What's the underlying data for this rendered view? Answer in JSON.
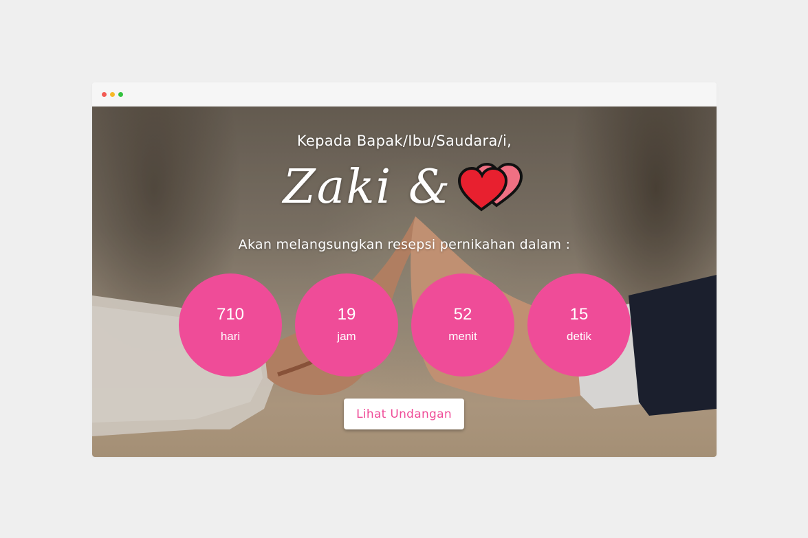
{
  "window": {
    "controls": [
      "close",
      "minimize",
      "maximize"
    ]
  },
  "hero": {
    "greeting": "Kepada Bapak/Ibu/Saudara/i,",
    "names": "Zaki &",
    "heart_icon": "double-heart-icon",
    "subtitle": "Akan melangsungkan resepsi pernikahan dalam :"
  },
  "countdown": [
    {
      "value": "710",
      "unit": "hari"
    },
    {
      "value": "19",
      "unit": "jam"
    },
    {
      "value": "52",
      "unit": "menit"
    },
    {
      "value": "15",
      "unit": "detik"
    }
  ],
  "cta": {
    "label": "Lihat Undangan"
  },
  "colors": {
    "accent": "#ef4c98",
    "heart_front": "#e8202f",
    "heart_back": "#f07083",
    "background": "#efefef"
  }
}
